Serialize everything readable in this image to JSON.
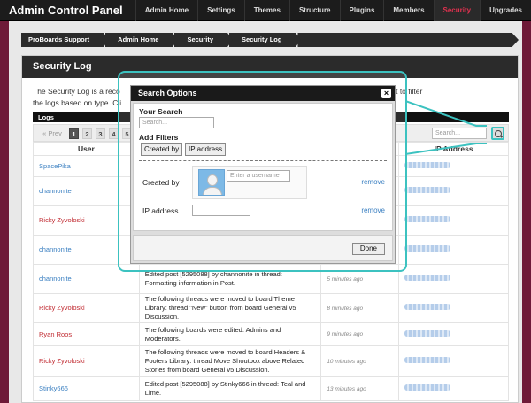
{
  "app": {
    "title": "Admin Control Panel"
  },
  "nav": [
    "Admin Home",
    "Settings",
    "Themes",
    "Structure",
    "Plugins",
    "Members",
    "Security",
    "Upgrades"
  ],
  "nav_active": "Security",
  "breadcrumb": [
    "ProBoards Support",
    "Admin Home",
    "Security",
    "Security Log"
  ],
  "page": {
    "title": "Security Log",
    "intro_left": "The Security Log is a reco",
    "intro_right": "n in the top right to filter",
    "intro_line2_left": "the logs based on type. Cli"
  },
  "logs": {
    "heading": "Logs",
    "prev_label": "« Prev",
    "pages": [
      "1",
      "2",
      "3",
      "4",
      "5"
    ],
    "current_page": "1",
    "search_placeholder": "Search...",
    "columns": {
      "user": "User",
      "ip": "IP Address"
    },
    "rows": [
      {
        "user": "SpacePika",
        "user_color": "#3a7fc1",
        "action": "",
        "time": ""
      },
      {
        "user": "channonite",
        "user_color": "#3a7fc1",
        "action": "",
        "time": ""
      },
      {
        "user": "Ricky Zyvoloski",
        "user_color": "#c0282f",
        "action": "",
        "time": ""
      },
      {
        "user": "channonite",
        "user_color": "#3a7fc1",
        "action": "board General v5 Discussion.",
        "time": ""
      },
      {
        "user": "channonite",
        "user_color": "#3a7fc1",
        "action": "Edited post [5295088] by channonite in thread: Formatting information in Post.",
        "time": "5 minutes ago"
      },
      {
        "user": "Ricky Zyvoloski",
        "user_color": "#c0282f",
        "action": "The following threads were moved to board Theme Library: thread \"New\" button from board General v5 Discussion.",
        "time": "8 minutes ago"
      },
      {
        "user": "Ryan Roos",
        "user_color": "#c0282f",
        "action": "The following boards were edited: Admins and Moderators.",
        "time": "9 minutes ago"
      },
      {
        "user": "Ricky Zyvoloski",
        "user_color": "#c0282f",
        "action": "The following threads were moved to board Headers & Footers Library: thread Move Shoutbox above Related Stories from board General v5 Discussion.",
        "time": "10 minutes ago"
      },
      {
        "user": "Stinky666",
        "user_color": "#3a7fc1",
        "action": "Edited post [5295088] by Stinky666 in thread: Teal and Lime.",
        "time": "13 minutes ago"
      }
    ]
  },
  "dialog": {
    "title": "Search Options",
    "close_label": "×",
    "your_search_label": "Your Search",
    "search_placeholder": "Search...",
    "add_filters_label": "Add Filters",
    "filter_buttons": [
      "Created by",
      "IP address"
    ],
    "created_by_label": "Created by",
    "username_placeholder": "Enter a username",
    "ip_label": "IP address",
    "remove_label": "remove",
    "done_label": "Done"
  },
  "colors": {
    "accent": "#3cc2c0",
    "link": "#3a7fc1",
    "member_red": "#c0282f",
    "nav_active": "#e0314f",
    "background": "#6e1a38"
  }
}
